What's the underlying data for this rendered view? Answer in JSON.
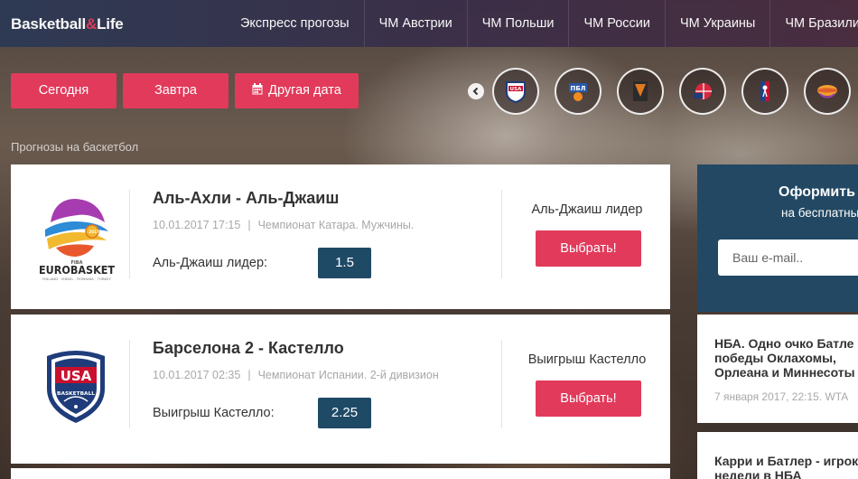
{
  "header": {
    "logo": {
      "part1": "Basketball",
      "amp": "&",
      "part2": "Life"
    },
    "nav": [
      "Экспресс прогозы",
      "ЧМ Австрии",
      "ЧМ Польши",
      "ЧМ России",
      "ЧМ Украины",
      "ЧМ Бразилии"
    ]
  },
  "date_filters": {
    "today": "Сегодня",
    "tomorrow": "Завтра",
    "other_date": "Другая дата",
    "other_date_icon": "calendar-icon"
  },
  "leagues": {
    "prev_icon": "chevron-left-icon",
    "items": [
      {
        "name": "usa-basketball",
        "icon": "usa-basketball-logo",
        "color": "#1f3c7a",
        "text": "USA"
      },
      {
        "name": "pbl",
        "icon": "pbl-logo",
        "color": "#2a5aa8",
        "text": "ПБЛ"
      },
      {
        "name": "vtb",
        "icon": "vtb-league-logo",
        "color": "#e07a1f",
        "text": ""
      },
      {
        "name": "league-red",
        "icon": "basketball-league-logo",
        "color": "#d8283f",
        "text": ""
      },
      {
        "name": "nba",
        "icon": "nba-logo",
        "color": "#c8102e",
        "text": ""
      },
      {
        "name": "league-ball",
        "icon": "basketball-ball-logo",
        "color": "#f0a030",
        "text": ""
      }
    ]
  },
  "breadcrumb": "Прогнозы на баскетбол",
  "matches": [
    {
      "title": "Аль-Ахли - Аль-Джаиш",
      "date": "10.01.2017 17:15",
      "separator": "|",
      "tournament": "Чемпионат Катара. Мужчины.",
      "pick": "Аль-Джаиш лидер:",
      "odds": "1.5",
      "right_label": "Аль-Джаиш лидер",
      "button": "Выбрать!",
      "logo": {
        "icon": "fiba-eurobasket-logo",
        "name": "EUROBASKET",
        "top_text": "FIBA",
        "bottom_text": "FINLAND · ISRAEL · ROMANIA · TURKEY",
        "year": "2017"
      }
    },
    {
      "title": "Барселона 2 - Кастелло",
      "date": "10.01.2017 02:35",
      "separator": "|",
      "tournament": "Чемпионат Испании. 2-й дивизион",
      "pick": "Выигрыш Кастелло:",
      "odds": "2.25",
      "right_label": "Выигрыш Кастелло",
      "button": "Выбрать!",
      "logo": {
        "icon": "usa-basketball-shield-logo",
        "name": "USA",
        "top_text": "",
        "bottom_text": "BASKETBALL",
        "year": ""
      }
    }
  ],
  "sidebar": {
    "subscribe": {
      "title": "Оформить",
      "subtitle": "на бесплатны",
      "email_placeholder": "Ваш e-mail.."
    },
    "news": [
      {
        "title": [
          "НБА. Одно очко Батле",
          "победы Оклахомы,",
          "Орлеана и Миннесоты"
        ],
        "date": "7 января 2017, 22:15. WTA"
      },
      {
        "title": [
          "Карри и Батлер - игрок",
          "недели в НБА"
        ],
        "date": ""
      }
    ]
  },
  "colors": {
    "accent": "#e23a5b",
    "odds_bg": "#1f4a66",
    "subscribe_bg": "#224863"
  }
}
